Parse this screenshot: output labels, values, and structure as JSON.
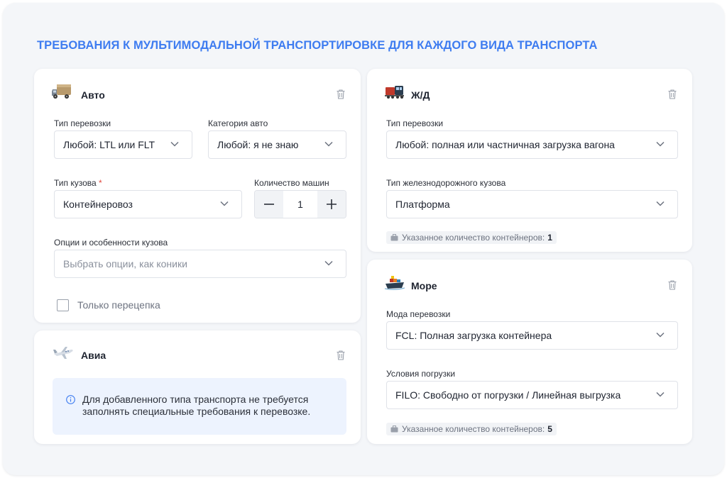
{
  "page": {
    "title": "ТРЕБОВАНИЯ К МУЛЬТИМОДАЛЬНОЙ ТРАНСПОРТИРОВКЕ ДЛЯ КАЖДОГО ВИДА ТРАНСПОРТА",
    "accent_color": "#3e7cf0"
  },
  "auto": {
    "title": "Авто",
    "icon": "truck-icon",
    "transport_type": {
      "label": "Тип перевозки",
      "value": "Любой: LTL или FLT"
    },
    "auto_category": {
      "label": "Категория авто",
      "value": "Любой: я не знаю"
    },
    "body_type": {
      "label": "Тип кузова",
      "required_mark": "*",
      "value": "Контейнеровоз"
    },
    "vehicle_count": {
      "label": "Количество машин",
      "value": "1"
    },
    "body_options": {
      "label": "Опции и особенности кузова",
      "placeholder": "Выбрать опции, как коники"
    },
    "trailer_only": {
      "label": "Только перецепка",
      "checked": false
    }
  },
  "air": {
    "title": "Авиа",
    "icon": "airplane-icon",
    "info_text": "Для добавленного типа транспорта не требуется заполнять специальные требования к перевозке."
  },
  "rail": {
    "title": "Ж/Д",
    "icon": "train-icon",
    "transport_type": {
      "label": "Тип перевозки",
      "value": "Любой: полная или частничная загрузка вагона"
    },
    "rail_body_type": {
      "label": "Тип железнодорожного кузова",
      "value": "Платформа"
    },
    "containers": {
      "label": "Указанное количество контейнеров:",
      "value": "1"
    }
  },
  "sea": {
    "title": "Море",
    "icon": "ship-icon",
    "mode": {
      "label": "Мода перевозки",
      "value": "FCL: Полная загрузка контейнера"
    },
    "loading_terms": {
      "label": "Условия погрузки",
      "value": "FILO: Свободно от погрузки / Линейная выгрузка"
    },
    "containers": {
      "label": "Указанное количество контейнеров:",
      "value": "5"
    }
  }
}
